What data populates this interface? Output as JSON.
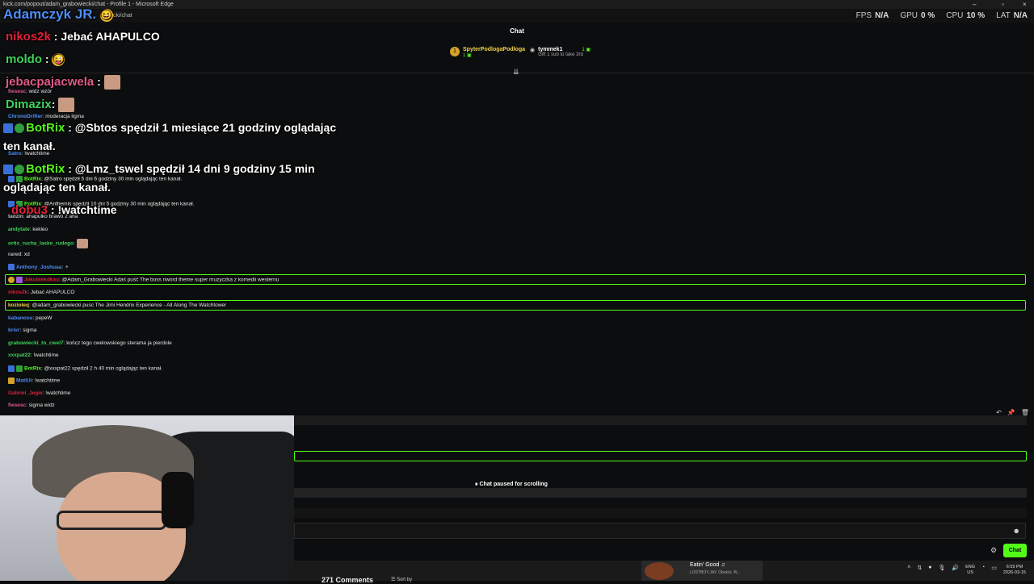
{
  "browser": {
    "title": "kick.com/popout/adam_grabowiecki/chat - Profile 1 - Microsoft Edge",
    "address_tail": "cki/chat"
  },
  "perf": [
    {
      "key": "FPS",
      "value": "N/A"
    },
    {
      "key": "GPU",
      "value": "0 %"
    },
    {
      "key": "CPU",
      "value": "10 %"
    },
    {
      "key": "LAT",
      "value": "N/A"
    }
  ],
  "chat": {
    "header": "Chat",
    "gifters": [
      {
        "name": "SpyterPodlogaPodloga",
        "count": "1",
        "rank": "1"
      },
      {
        "name": "tymmek1",
        "count": "1",
        "hint": "Gift 1 sub to take 3rd"
      }
    ]
  },
  "overlay": [
    {
      "user": "Adamczyk JR.",
      "text": "",
      "color": "#4f8ef7"
    },
    {
      "user": "nikos2k",
      "text": ": Jebać AHAPULCO",
      "color": "#e0203a"
    },
    {
      "user": "moldo",
      "text": ":",
      "color": "#3fd35d"
    },
    {
      "user": "jebacpajacwela",
      "text": ":",
      "color": "#e05b8a"
    },
    {
      "user": "Dimazix",
      "text": ":",
      "color": "#3fd35d"
    },
    {
      "user": "BotRix",
      "text": ": @Sbtos spędził 1 miesiące 21 godziny oglądając",
      "text2": "ten kanał.",
      "color": "#53fc18"
    },
    {
      "user": "BotRix",
      "text": ": @Lmz_tswel spędził 14 dni 9 godziny 15 min",
      "text2": "oglądając ten kanał.",
      "color": "#53fc18"
    },
    {
      "user": "dobu3",
      "text": ": !watchtime",
      "color": "#e0203a"
    }
  ],
  "messages": [
    {
      "user": "fiesesc",
      "text": ": widz wzór",
      "color": "#e05b8a"
    },
    {
      "user": "ChronoDrifter",
      "text": ": moderacja ligma",
      "color": "#4f8ef7"
    },
    {
      "user": "Satro",
      "text": ": !watchtime",
      "color": "#4f8ef7"
    },
    {
      "user": "BotRix",
      "text": ": @Satro spędził 5 dni 6 godziny 30 min oglądając ten kanał.",
      "color": "#53fc18"
    },
    {
      "user": "BotRix",
      "text": ": @Anthemis spędził 10 dni 5 godziny 30 min oglądając ten kanał.",
      "color": "#53fc18"
    },
    {
      "user": "tadzin",
      "text": ": ahapulko brawo 2 aha",
      "color": "#bbbbbb"
    },
    {
      "user": "andytate",
      "text": ": kekleo",
      "color": "#3fd35d"
    },
    {
      "user": "ortis_rucha_laske_rudego",
      "text": ":",
      "color": "#3fd35d"
    },
    {
      "user": "rared",
      "text": ": xd",
      "color": "#bbbbbb"
    },
    {
      "user": "Anthony_Joshuaa",
      "text": ":",
      "color": "#4f8ef7"
    },
    {
      "user": "Jakubiekdkau",
      "text": ": @Adam_Grabowiecki Adaś puść The boss nword theme super muzyczka z komedii westernu",
      "color": "#e0203a"
    },
    {
      "user": "nikos2k",
      "text": ": Jebać AHAPULCO",
      "color": "#e0203a"
    },
    {
      "user": "kozioleq",
      "text": ": @adam_grabowiecki pusc The Jimi Hendrix Experience - All Along The Watchtower",
      "color": "#f0d24a"
    },
    {
      "user": "kabanosu",
      "text": ": pepeW",
      "color": "#4f8ef7"
    },
    {
      "user": "brivr",
      "text": ": sigma",
      "color": "#4f8ef7"
    },
    {
      "user": "grabowiecki_to_cwel7",
      "text": ": kończ tego cwelowskiego sterama ja pierdole",
      "color": "#3fd35d"
    },
    {
      "user": "xxxpat22",
      "text": ": !watchtime",
      "color": "#3fd35d"
    },
    {
      "user": "BotRix",
      "text": ": @xxxpat22 spędził 2 h 40 min oglądając ten kanał.",
      "color": "#53fc18"
    },
    {
      "user": "MatiUi",
      "text": ": !watchtime",
      "color": "#4f8ef7"
    },
    {
      "user": "Gabriel_Jegie",
      "text": ": !watchtime",
      "color": "#e0203a"
    },
    {
      "user": "fiesesc",
      "text": ": sigma widz",
      "color": "#e05b8a"
    }
  ],
  "paused_label": "Chat paused for scrolling",
  "chat_button": "Chat",
  "taskbar": {
    "comments": "271 Comments",
    "sort": "Sort by",
    "media_title": "Eatin' Good ♫",
    "media_artist": "LOSTBOY.JAY, Obskür, W...",
    "lang1": "ENG",
    "lang2": "US",
    "time": "6:59 PM",
    "date": "2026-03-15"
  }
}
